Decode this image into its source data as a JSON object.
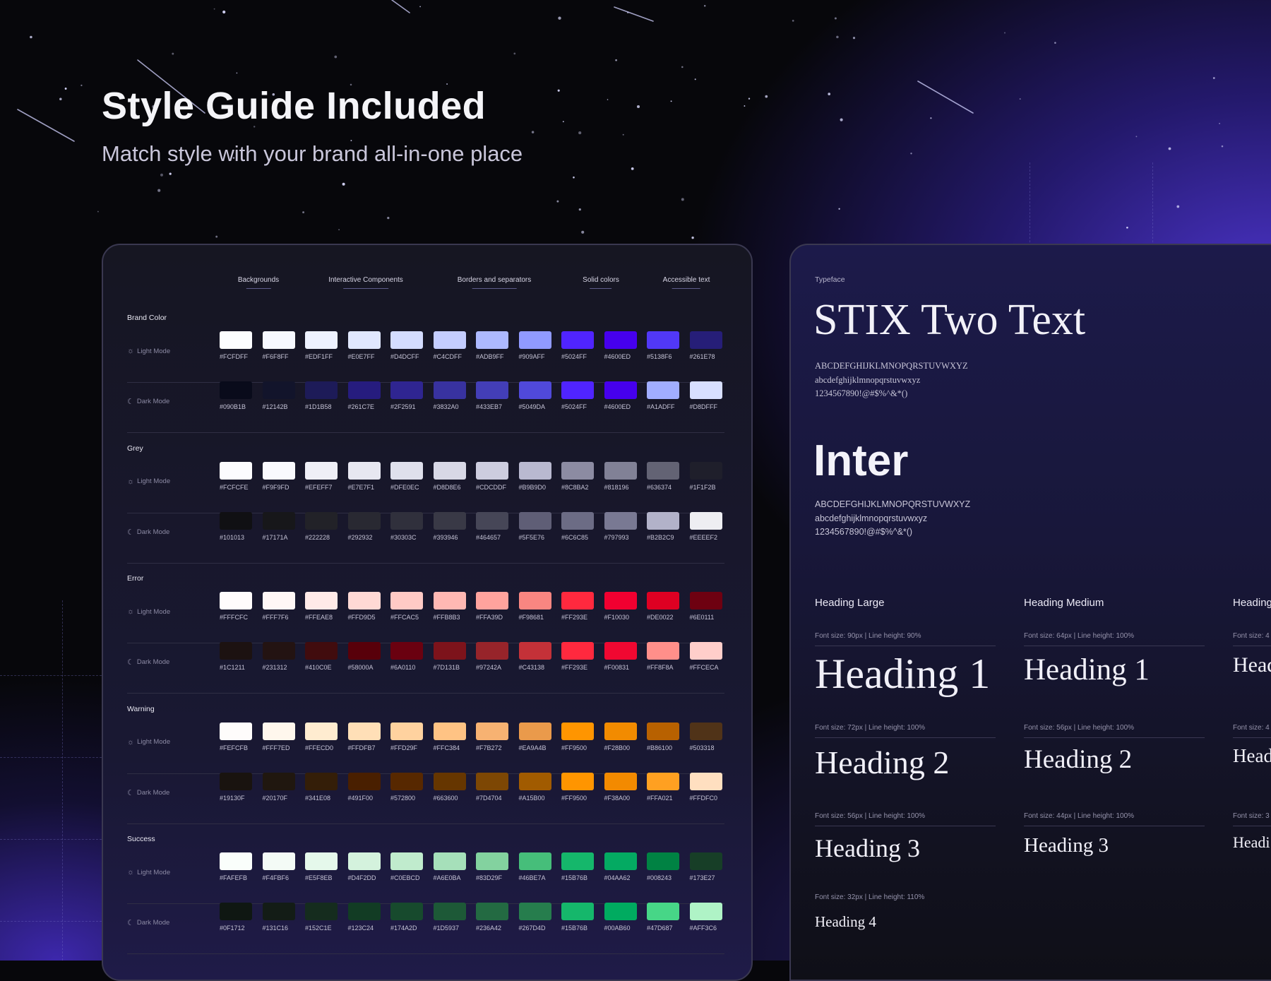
{
  "hero": {
    "title": "Style Guide Included",
    "subtitle": "Match style with your brand all-in-one place"
  },
  "palette": {
    "columns": [
      "Backgrounds",
      "Interactive Components",
      "Borders and separators",
      "Solid colors",
      "Accessible text"
    ],
    "light_label": "Light Mode",
    "dark_label": "Dark Mode",
    "groups": [
      {
        "name": "Brand Color",
        "light": [
          "#FCFDFF",
          "#F6F8FF",
          "#EDF1FF",
          "#E0E7FF",
          "#D4DCFF",
          "#C4CDFF",
          "#ADB9FF",
          "#909AFF",
          "#5024FF",
          "#4600ED",
          "#5138F6",
          "#261E78"
        ],
        "dark": [
          "#090B1B",
          "#12142B",
          "#1D1B58",
          "#261C7E",
          "#2F2591",
          "#3832A0",
          "#433EB7",
          "#5049DA",
          "#5024FF",
          "#4600ED",
          "#A1ADFF",
          "#D8DFFF"
        ]
      },
      {
        "name": "Grey",
        "light": [
          "#FCFCFE",
          "#F9F9FD",
          "#EFEFF7",
          "#E7E7F1",
          "#DFE0EC",
          "#D8D8E6",
          "#CDCDDF",
          "#B9B9D0",
          "#8C8BA2",
          "#818196",
          "#636374",
          "#1F1F2B"
        ],
        "dark": [
          "#101013",
          "#17171A",
          "#222228",
          "#292932",
          "#30303C",
          "#393946",
          "#464657",
          "#5F5E76",
          "#6C6C85",
          "#797993",
          "#B2B2C9",
          "#EEEEF2"
        ]
      },
      {
        "name": "Error",
        "light": [
          "#FFFCFC",
          "#FFF7F6",
          "#FFEAE8",
          "#FFD9D5",
          "#FFCAC5",
          "#FFB8B3",
          "#FFA39D",
          "#F98681",
          "#FF293E",
          "#F10030",
          "#DE0022",
          "#6E0111"
        ],
        "dark": [
          "#1C1211",
          "#231312",
          "#410C0E",
          "#58000A",
          "#6A0110",
          "#7D131B",
          "#97242A",
          "#C43138",
          "#FF293E",
          "#F00831",
          "#FF8F8A",
          "#FFCECA"
        ]
      },
      {
        "name": "Warning",
        "light": [
          "#FEFCFB",
          "#FFF7ED",
          "#FFECD0",
          "#FFDFB7",
          "#FFD29F",
          "#FFC384",
          "#F7B272",
          "#EA9A4B",
          "#FF9500",
          "#F28B00",
          "#B86100",
          "#503318"
        ],
        "dark": [
          "#19130F",
          "#20170F",
          "#341E08",
          "#491F00",
          "#572800",
          "#663600",
          "#7D4704",
          "#A15B00",
          "#FF9500",
          "#F38A00",
          "#FFA021",
          "#FFDFC0"
        ]
      },
      {
        "name": "Success",
        "light": [
          "#FAFEFB",
          "#F4FBF6",
          "#E5F8EB",
          "#D4F2DD",
          "#C0EBCD",
          "#A6E0BA",
          "#83D29F",
          "#46BE7A",
          "#15B76B",
          "#04AA62",
          "#008243",
          "#173E27"
        ],
        "dark": [
          "#0F1712",
          "#131C16",
          "#152C1E",
          "#123C24",
          "#174A2D",
          "#1D5937",
          "#236A42",
          "#267D4D",
          "#15B76B",
          "#00AB60",
          "#47D687",
          "#AFF3C6"
        ]
      }
    ]
  },
  "typeface": {
    "label": "Typeface",
    "serif_name": "STIX Two Text",
    "sans_name": "Inter",
    "sample_upper": "ABCDEFGHIJKLMNOPQRSTUVWXYZ",
    "sample_lower": "abcdefghijklmnopqrstuvwxyz",
    "sample_digits": "1234567890!@#$%^&*()",
    "columns": [
      {
        "title": "Heading Large",
        "rows": [
          {
            "meta": "Font size: 90px | Line height: 90%",
            "text": "Heading 1"
          },
          {
            "meta": "Font size: 72px | Line height: 100%",
            "text": "Heading 2"
          },
          {
            "meta": "Font size: 56px | Line height: 100%",
            "text": "Heading 3"
          },
          {
            "meta": "Font size: 32px | Line height: 110%",
            "text": "Heading 4"
          }
        ]
      },
      {
        "title": "Heading Medium",
        "rows": [
          {
            "meta": "Font size: 64px | Line height: 100%",
            "text": "Heading 1"
          },
          {
            "meta": "Font size: 56px | Line height: 100%",
            "text": "Heading 2"
          },
          {
            "meta": "Font size: 44px | Line height: 100%",
            "text": "Heading 3"
          }
        ]
      },
      {
        "title": "Heading",
        "rows": [
          {
            "meta": "Font size: 4",
            "text": "Head"
          },
          {
            "meta": "Font size: 4",
            "text": "Head"
          },
          {
            "meta": "Font size: 3",
            "text": "Headi"
          }
        ]
      }
    ]
  }
}
